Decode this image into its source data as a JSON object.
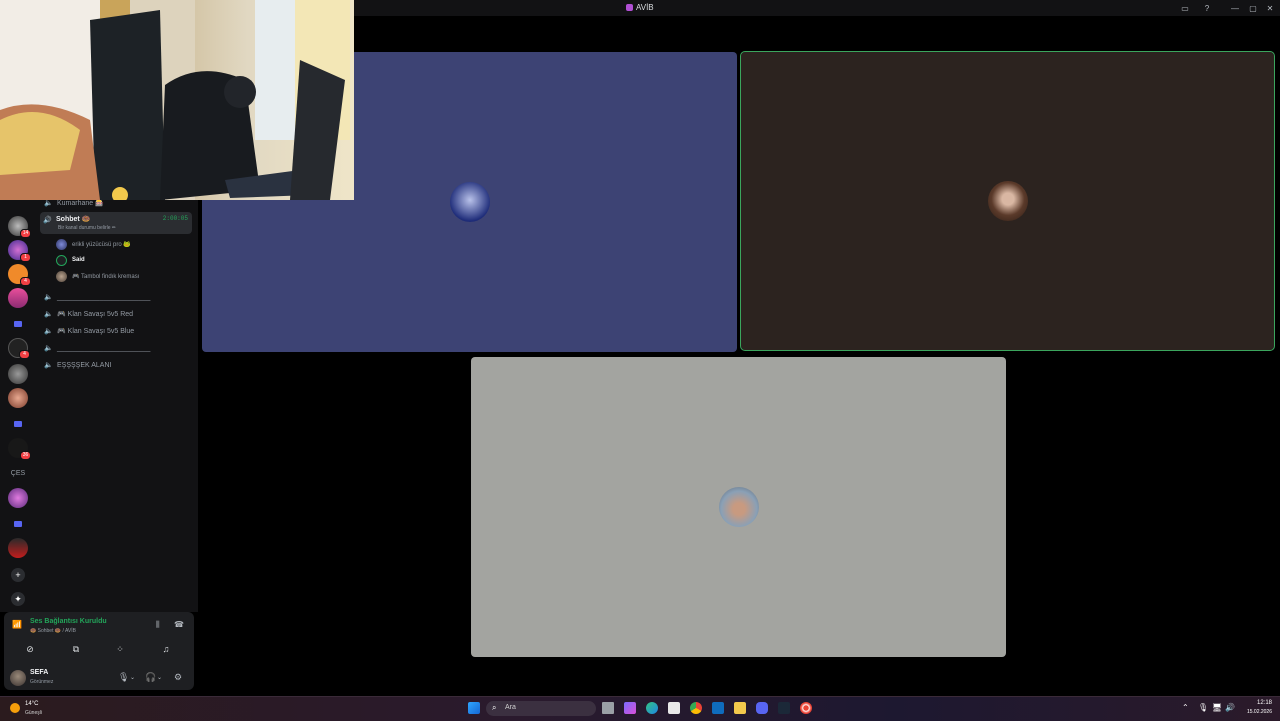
{
  "window": {
    "title": "AVİB",
    "controls": [
      "inbox-icon",
      "help-icon",
      "minimize-icon",
      "maximize-icon",
      "close-icon"
    ]
  },
  "servers": {
    "badges": [
      "14",
      "1",
      "4",
      "4",
      "36"
    ],
    "text_item": "ÇES"
  },
  "channels": {
    "items": [
      {
        "name": "Kumarhane 🎰"
      },
      {
        "name": "Sohbet 🍩",
        "active": true,
        "subtitle": "Bir kanal durumu belirle ✏",
        "timer": "2:00:05"
      },
      {
        "name": "________________________"
      },
      {
        "name": "🎮 Klan Savaşı 5v5 Red"
      },
      {
        "name": "🎮 Klan Savaşı 5v5 Blue"
      },
      {
        "name": "________________________"
      },
      {
        "name": "EŞŞŞŞEK ALANI"
      }
    ],
    "members": [
      {
        "name": "erikli yüzücüsü pro 🐸"
      },
      {
        "name": "Said"
      },
      {
        "name": "🎮 Tambol findık kreması"
      }
    ]
  },
  "voice": {
    "status": "Ses Bağlantısı Kuruldu",
    "location": "🍩 Sohbet 🍩 / AVİB"
  },
  "user": {
    "name": "SEFA",
    "status": "Görünmez"
  },
  "stage": {
    "tiles": [
      {
        "color": "#3d4374"
      },
      {
        "color": "#2c231f",
        "speaking": true,
        "speaking_color": "#3ba55d"
      },
      {
        "color": "#a3a4a0"
      }
    ]
  },
  "taskbar": {
    "weather_temp": "14°C",
    "weather_desc": "Güneşli",
    "search_placeholder": "Ara",
    "time": "12:18",
    "date": "15.02.2026"
  }
}
